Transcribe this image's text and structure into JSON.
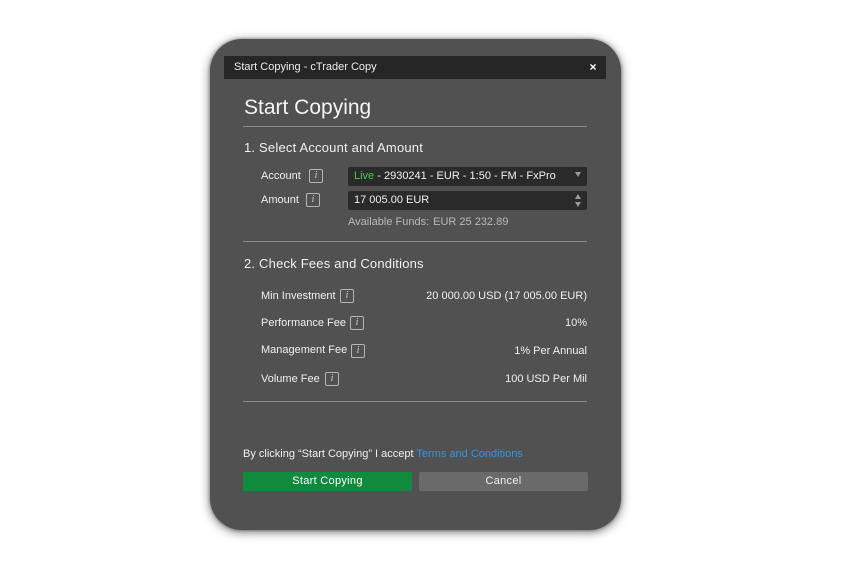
{
  "window": {
    "title": "Start Copying - cTrader Copy",
    "close_glyph": "×"
  },
  "heading": "Start Copying",
  "section1": {
    "title": "1. Select Account and Amount",
    "account": {
      "label": "Account",
      "live": "Live",
      "value": " - 2930241 - EUR - 1:50 - FM - FxPro"
    },
    "amount": {
      "label": "Amount",
      "value": "17 005.00 EUR"
    },
    "available_label": "Available Funds:",
    "available_value": "EUR 25 232.89"
  },
  "section2": {
    "title": "2. Check Fees and Conditions",
    "fees": [
      {
        "label": "Min Investment",
        "value": "20 000.00 USD (17 005.00 EUR)"
      },
      {
        "label": "Performance Fee",
        "value": "10%"
      },
      {
        "label": "Management Fee",
        "value": "1% Per Annual"
      },
      {
        "label": "Volume Fee",
        "value": "100 USD Per Mil"
      }
    ]
  },
  "terms": {
    "prefix": "By clicking “Start Copying” I accept ",
    "link": "Terms and Conditions"
  },
  "buttons": {
    "start": "Start Copying",
    "cancel": "Cancel"
  },
  "icons": {
    "info": "i"
  },
  "colors": {
    "dialog_bg": "#515151",
    "titlebar_bg": "#262626",
    "live": "#3ed14a",
    "link": "#2f97e8",
    "primary_button": "#128a3e",
    "secondary_button": "#6a6a6a"
  }
}
